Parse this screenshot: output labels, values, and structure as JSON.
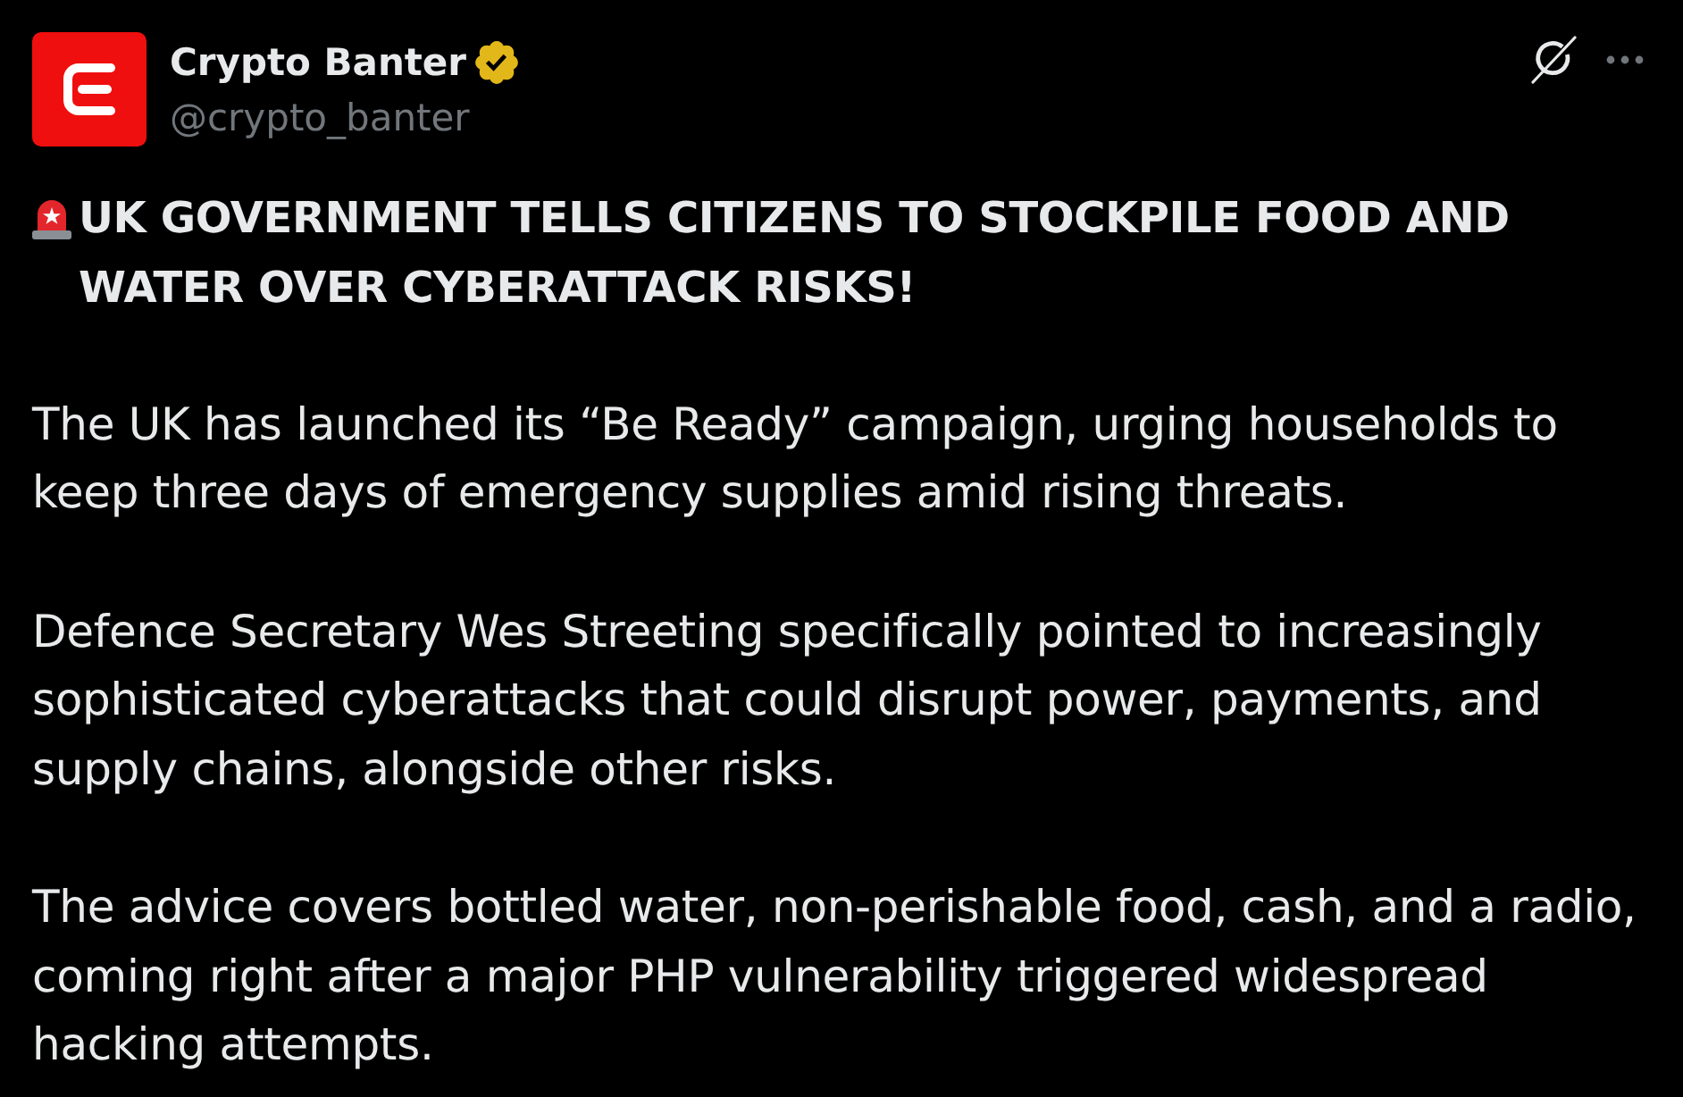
{
  "post": {
    "author": {
      "name": "Crypto Banter",
      "verified": true,
      "handle": "@crypto_banter"
    },
    "headline": "UK GOVERNMENT TELLS CITIZENS TO STOCKPILE FOOD AND WATER OVER CYBERATTACK RISKS!",
    "paragraphs": [
      "The UK has launched its “Be Ready” campaign, urging households to keep three days of emergency supplies amid rising threats.",
      "Defence Secretary Wes Streeting specifically pointed to increasingly sophisticated cyberattacks that could disrupt power, payments, and supply chains, alongside other risks.",
      "The advice covers bottled water, non-perishable food, cash, and a radio, coming right after a major PHP vulnerability triggered widespread hacking attempts."
    ]
  }
}
